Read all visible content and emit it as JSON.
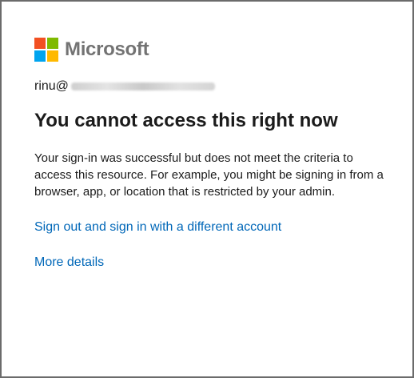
{
  "brand": {
    "name": "Microsoft",
    "logo_colors": [
      "#f25022",
      "#7fba00",
      "#00a4ef",
      "#ffb900"
    ]
  },
  "account": {
    "prefix": "rinu@"
  },
  "heading": "You cannot access this right now",
  "description": "Your sign-in was successful but does not meet the criteria to access this resource. For example, you might be signing in from a browser, app, or location that is restricted by your admin.",
  "links": {
    "sign_out": "Sign out and sign in with a different account",
    "more_details": "More details"
  },
  "colors": {
    "link": "#0067b8",
    "text": "#1b1b1b",
    "brand_text": "#737373"
  }
}
